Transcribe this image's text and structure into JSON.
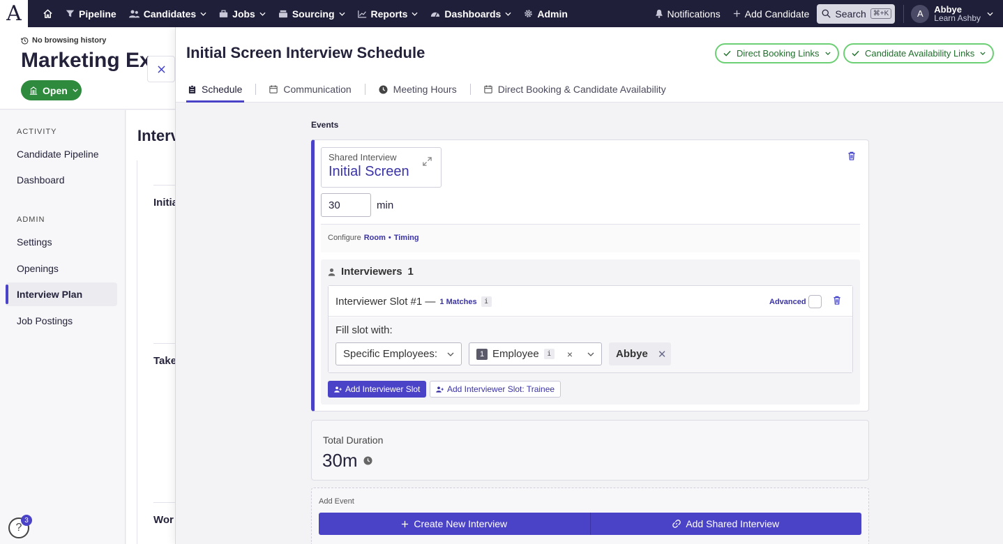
{
  "nav": {
    "logo": "A",
    "items": [
      {
        "label": "Pipeline",
        "icon": "filter-icon"
      },
      {
        "label": "Candidates",
        "icon": "users-icon"
      },
      {
        "label": "Jobs",
        "icon": "briefcase-icon"
      },
      {
        "label": "Sourcing",
        "icon": "sourcing-icon"
      },
      {
        "label": "Reports",
        "icon": "chart-icon"
      },
      {
        "label": "Dashboards",
        "icon": "gauge-icon"
      },
      {
        "label": "Admin",
        "icon": "gear-icon"
      }
    ],
    "notifications": "Notifications",
    "add_candidate": "Add Candidate",
    "search": "Search",
    "search_shortcut": "⌘+K",
    "user": {
      "initial": "A",
      "name": "Abbye",
      "org": "Learn Ashby"
    }
  },
  "page": {
    "browsing_history": "No browsing history",
    "job_title": "Marketing Exec",
    "status": "Open",
    "behind_heading": "Interv",
    "behind_rows": [
      "Initia",
      "Take",
      "Wor"
    ]
  },
  "sidebar": {
    "activity_label": "ACTIVITY",
    "activity_items": [
      "Candidate Pipeline",
      "Dashboard"
    ],
    "admin_label": "ADMIN",
    "admin_items": [
      "Settings",
      "Openings",
      "Interview Plan",
      "Job Postings"
    ],
    "active_item": "Interview Plan"
  },
  "help": {
    "badge": "3",
    "glyph": "?"
  },
  "drawer": {
    "title": "Initial Screen Interview Schedule",
    "direct_booking_links": "Direct Booking Links",
    "candidate_availability_links": "Candidate Availability Links",
    "tabs": [
      "Schedule",
      "Communication",
      "Meeting Hours",
      "Direct Booking & Candidate Availability"
    ],
    "active_tab": "Schedule",
    "events_label": "Events",
    "event": {
      "shared_label": "Shared Interview",
      "name": "Initial Screen",
      "duration": "30",
      "duration_unit": "min",
      "configure_label": "Configure",
      "configure_room": "Room",
      "configure_sep": "•",
      "configure_timing": "Timing",
      "interviewers_label": "Interviewers",
      "interviewers_count": "1",
      "slot_title": "Interviewer Slot #1 —",
      "slot_matches": "1 Matches",
      "advanced_label": "Advanced",
      "fill_slot_label": "Fill slot with:",
      "fill_type": "Specific Employees:",
      "employee_count": "1",
      "employee_label": "Employee",
      "selected_employee": "Abbye",
      "add_slot": "Add Interviewer Slot",
      "add_trainee_slot": "Add Interviewer Slot: Trainee"
    },
    "total_duration_label": "Total Duration",
    "total_duration": "30m",
    "add_event_label": "Add Event",
    "create_new_interview": "Create New Interview",
    "add_shared_interview": "Add Shared Interview"
  },
  "colors": {
    "accent": "#4b43c7",
    "nav_bg": "#1f1f3a",
    "open_green": "#2e8b3e",
    "link_green_border": "#6ccf73"
  }
}
